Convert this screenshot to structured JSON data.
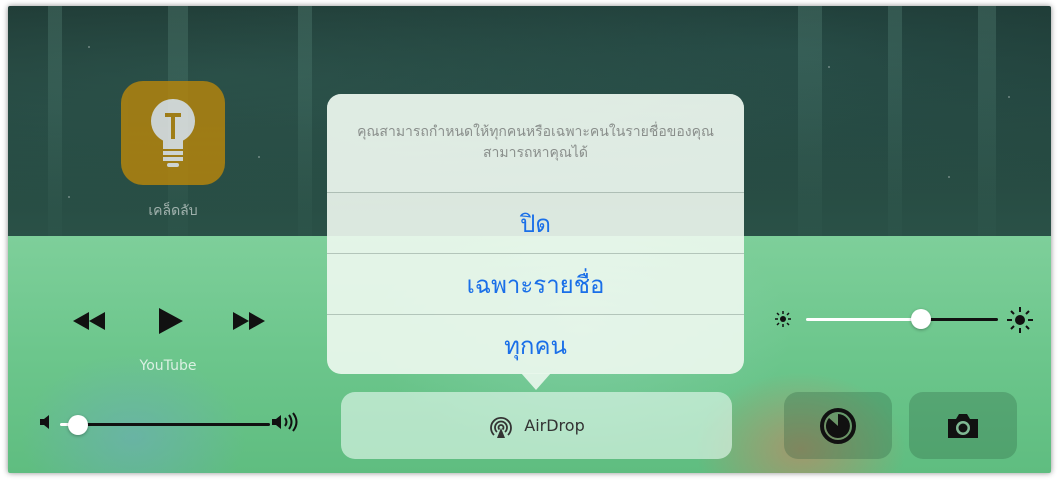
{
  "app": {
    "label": "เคล็ดลับ",
    "icon": "lightbulb-icon",
    "color": "#b8860b"
  },
  "media": {
    "source_label": "YouTube",
    "controls": [
      {
        "name": "rewind-icon"
      },
      {
        "name": "play-icon"
      },
      {
        "name": "fast-forward-icon"
      }
    ]
  },
  "volume": {
    "level": 0.05,
    "min_icon": "speaker-low-icon",
    "max_icon": "speaker-high-icon"
  },
  "brightness": {
    "level": 0.58,
    "min_icon": "sun-small-icon",
    "max_icon": "sun-large-icon"
  },
  "airdrop": {
    "label": "AirDrop",
    "icon": "airdrop-icon"
  },
  "popover": {
    "message": "คุณสามารถกำหนดให้ทุกคนหรือเฉพาะคนในรายชื่อของคุณสามารถหาคุณได้",
    "options": [
      "ปิด",
      "เฉพาะรายชื่อ",
      "ทุกคน"
    ],
    "option_color": "#1a6fe8"
  },
  "buttons": {
    "timer": "timer-icon",
    "camera": "camera-icon"
  }
}
